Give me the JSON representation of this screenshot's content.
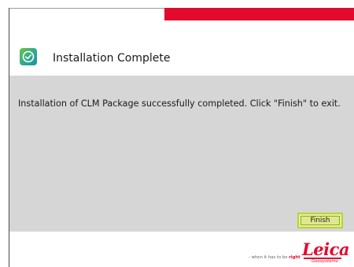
{
  "header": {
    "title": "Installation Complete",
    "icon": "check-circle-icon"
  },
  "content": {
    "message": "Installation of CLM Package successfully completed. Click \"Finish\" to exit."
  },
  "actions": {
    "finish_label": "Finish"
  },
  "footer": {
    "tagline_prefix": "- when it has to be ",
    "tagline_emphasis": "right",
    "logo_wordmark": "Leica",
    "logo_subtitle": "Geosystems"
  },
  "colors": {
    "accent": "#e30a30",
    "content_background": "#d6d6d6",
    "button_highlight": "#b9d433"
  }
}
